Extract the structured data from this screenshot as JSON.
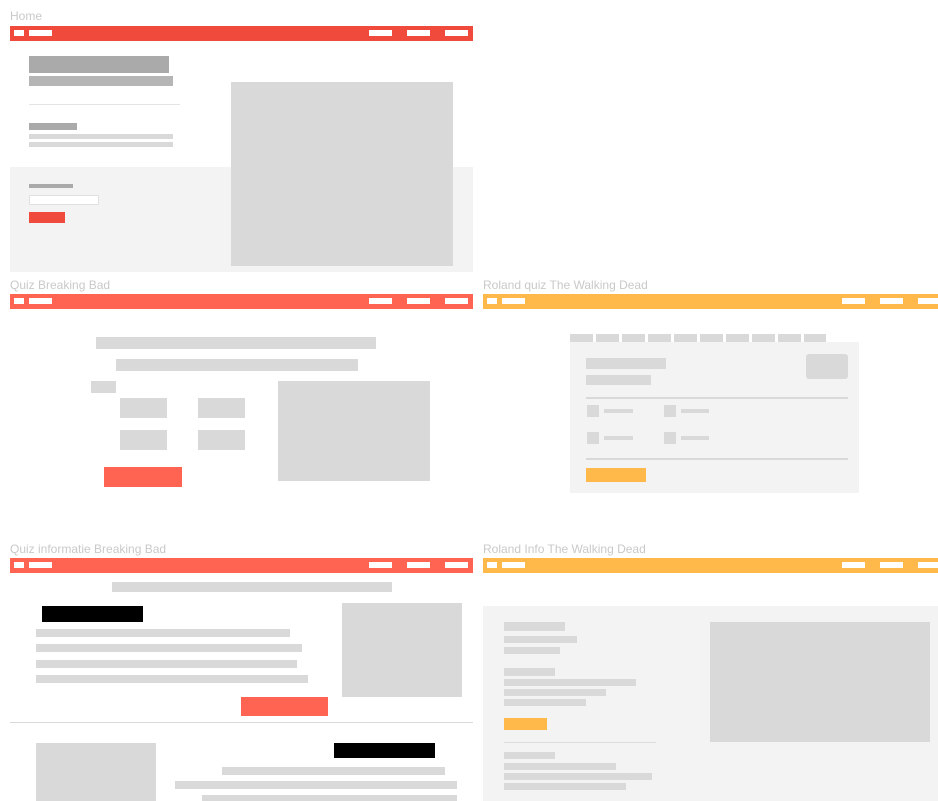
{
  "colors": {
    "red": "#f04a3c",
    "salmon": "#ff6452",
    "orange": "#ffb84a",
    "gray": "#d9d9d9",
    "panel": "#f3f3f3"
  },
  "frames": {
    "home": {
      "title": "Home"
    },
    "quiz_breaking_bad": {
      "title": "Quiz Breaking Bad"
    },
    "roland_quiz": {
      "title": "Roland quiz The Walking Dead"
    },
    "quiz_info": {
      "title": "Quiz informatie Breaking Bad"
    },
    "roland_info": {
      "title": "Roland Info The Walking Dead"
    }
  }
}
